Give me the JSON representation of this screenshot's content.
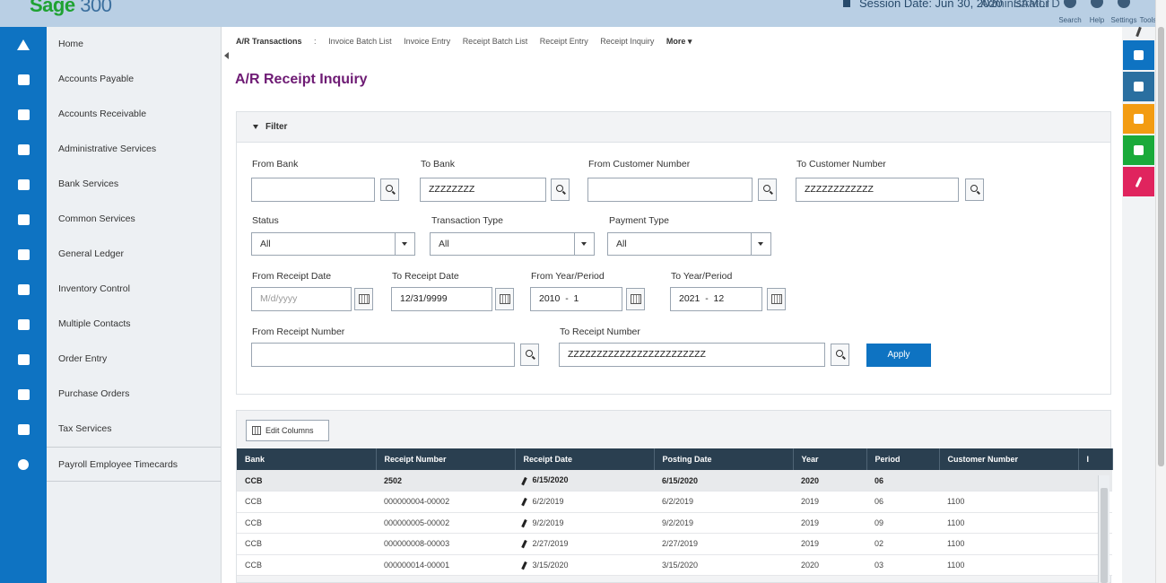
{
  "header": {
    "logo": "Sage",
    "logo_version": "300",
    "session": "Session Date: Jun 30, 2020",
    "user": "Administrator",
    "company": "SAMLTD",
    "icons": [
      {
        "label": "Search",
        "icon": "search-icon"
      },
      {
        "label": "Help",
        "icon": "help-icon"
      },
      {
        "label": "Settings",
        "icon": "gear-icon"
      },
      {
        "label": "Tools",
        "icon": "wrench-icon"
      }
    ]
  },
  "nav": {
    "items": [
      {
        "label": "Home",
        "icon": "home-icon"
      },
      {
        "label": "Accounts Payable",
        "icon": "payable-icon"
      },
      {
        "label": "Accounts Receivable",
        "icon": "receivable-icon"
      },
      {
        "label": "Administrative Services",
        "icon": "lock-icon"
      },
      {
        "label": "Bank Services",
        "icon": "bank-icon"
      },
      {
        "label": "Common Services",
        "icon": "briefcase-icon"
      },
      {
        "label": "General Ledger",
        "icon": "folder-icon"
      },
      {
        "label": "Inventory Control",
        "icon": "inventory-icon"
      },
      {
        "label": "Multiple Contacts",
        "icon": "contacts-icon"
      },
      {
        "label": "Order Entry",
        "icon": "order-icon"
      },
      {
        "label": "Purchase Orders",
        "icon": "purchase-icon"
      },
      {
        "label": "Tax Services",
        "icon": "percent-icon"
      },
      {
        "label": "Payroll Employee Timecards",
        "icon": "clock-icon"
      }
    ]
  },
  "breadcrumb": {
    "current": "A/R Transactions",
    "separator": ":",
    "links": [
      "Invoice Batch List",
      "Invoice Entry",
      "Receipt Batch List",
      "Receipt Entry",
      "Receipt Inquiry"
    ],
    "more": "More ▾"
  },
  "page": {
    "title": "A/R Receipt Inquiry"
  },
  "filter": {
    "title": "Filter",
    "from_bank": {
      "label": "From Bank",
      "value": ""
    },
    "to_bank": {
      "label": "To Bank",
      "value": "ZZZZZZZZ"
    },
    "from_customer": {
      "label": "From Customer Number",
      "value": ""
    },
    "to_customer": {
      "label": "To Customer Number",
      "value": "ZZZZZZZZZZZZ"
    },
    "status": {
      "label": "Status",
      "value": "All"
    },
    "transaction_type": {
      "label": "Transaction Type",
      "value": "All"
    },
    "payment_type": {
      "label": "Payment Type",
      "value": "All"
    },
    "from_receipt_date": {
      "label": "From Receipt Date",
      "placeholder": "M/d/yyyy"
    },
    "to_receipt_date": {
      "label": "To Receipt Date",
      "value": "12/31/9999"
    },
    "from_year_period": {
      "label": "From Year/Period",
      "value": "2010  -  1"
    },
    "to_year_period": {
      "label": "To Year/Period",
      "value": "2021  -  12"
    },
    "from_receipt_number": {
      "label": "From Receipt Number",
      "value": ""
    },
    "to_receipt_number": {
      "label": "To Receipt Number",
      "value": "ZZZZZZZZZZZZZZZZZZZZZZZZ"
    },
    "apply": "Apply"
  },
  "grid": {
    "edit_columns": "Edit Columns",
    "columns": [
      "Bank",
      "Receipt Number",
      "Receipt Date",
      "Posting Date",
      "Year",
      "Period",
      "Customer Number",
      "I"
    ],
    "rows": [
      {
        "bank": "CCB",
        "receipt": "2502",
        "receipt_date": "6/15/2020",
        "posting_date": "6/15/2020",
        "year": "2020",
        "period": "06",
        "customer": "",
        "selected": true
      },
      {
        "bank": "CCB",
        "receipt": "000000004-00002",
        "receipt_date": "6/2/2019",
        "posting_date": "6/2/2019",
        "year": "2019",
        "period": "06",
        "customer": "1100",
        "selected": false
      },
      {
        "bank": "CCB",
        "receipt": "000000005-00002",
        "receipt_date": "9/2/2019",
        "posting_date": "9/2/2019",
        "year": "2019",
        "period": "09",
        "customer": "1100",
        "selected": false
      },
      {
        "bank": "CCB",
        "receipt": "000000008-00003",
        "receipt_date": "2/27/2019",
        "posting_date": "2/27/2019",
        "year": "2019",
        "period": "02",
        "customer": "1100",
        "selected": false
      },
      {
        "bank": "CCB",
        "receipt": "000000014-00001",
        "receipt_date": "3/15/2020",
        "posting_date": "3/15/2020",
        "year": "2020",
        "period": "03",
        "customer": "1100",
        "selected": false
      }
    ]
  },
  "tools": [
    {
      "icon": "pin-icon",
      "color": "#ffffff"
    },
    {
      "icon": "window-icon",
      "color": "#0e73c2"
    },
    {
      "icon": "window-search-icon",
      "color": "#2a6fa0"
    },
    {
      "icon": "document-icon",
      "color": "#f39c12"
    },
    {
      "icon": "page-icon",
      "color": "#1aaa3a"
    },
    {
      "icon": "pen-icon",
      "color": "#e0245e"
    }
  ],
  "colors": {
    "accent": "#0e73c2",
    "title": "#6e1b74",
    "grid_header": "#2a3f50"
  }
}
